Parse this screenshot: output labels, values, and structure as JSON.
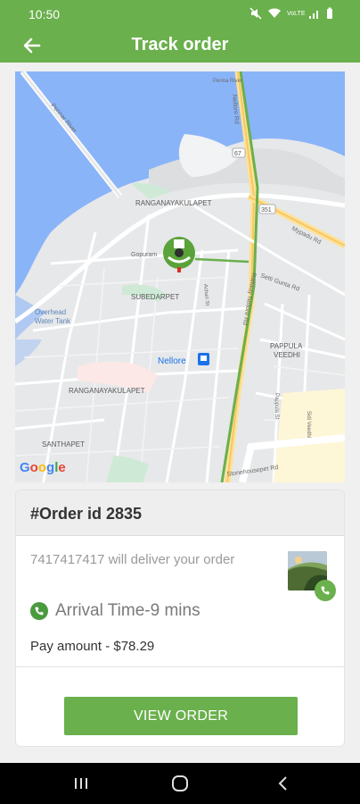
{
  "status": {
    "time": "10:50",
    "net": "VoLTE"
  },
  "appbar": {
    "title": "Track order"
  },
  "map": {
    "labels": {
      "pennar": "Pennar River",
      "penna": "Penna River",
      "nellore_rd": "Nellore Rd",
      "ranganayakulapet_top": "RANGANAYAKULAPET",
      "mypadu": "Mypadu Rd",
      "gopuram": "Gopuram",
      "subedarpet": "SUBEDARPET",
      "achari": "Achari St",
      "setti": "Setti Gunta Rd",
      "railway": "Railway Nellore Rd",
      "overhead": "Overhead\nWater Tank",
      "nellore": "Nellore",
      "pappula": "PAPPULA\nVEEDHI",
      "ranganayakulapet_bottom": "RANGANAYAKULAPET",
      "pappula_st": "Pappula St",
      "sidi": "Sidi Veedhi",
      "santhapet": "SANTHAPET",
      "stonehouse": "Stonehousepet Rd",
      "google": "Google",
      "shield67": "67",
      "shield351": "351"
    }
  },
  "order": {
    "id_label": "#Order id 2835",
    "deliver_text": "7417417417 will deliver your order",
    "arrival": "Arrival Time-9 mins",
    "pay": "Pay amount - $78.29",
    "view_button": "VIEW ORDER"
  },
  "colors": {
    "brand": "#6ab04c"
  }
}
